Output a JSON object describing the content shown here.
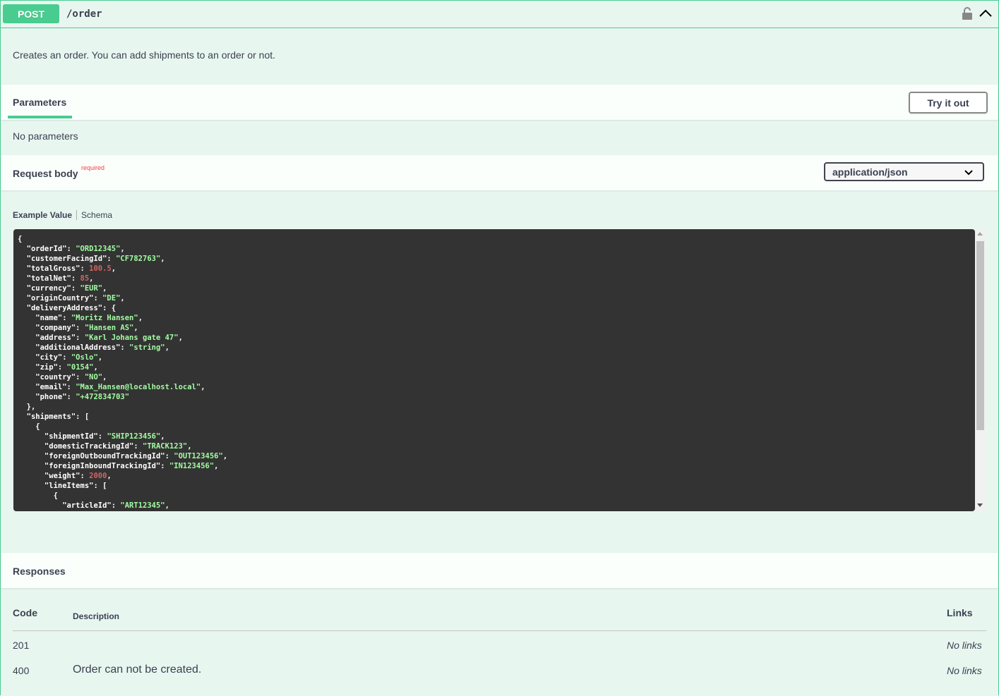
{
  "endpoint": {
    "method": "POST",
    "path": "/order",
    "description": "Creates an order. You can add shipments to an order or not."
  },
  "parameters": {
    "title": "Parameters",
    "try_button": "Try it out",
    "empty_text": "No parameters"
  },
  "request_body": {
    "title": "Request body",
    "required_label": "required",
    "content_type": "application/json",
    "tab_example": "Example Value",
    "tab_schema": "Schema",
    "example_lines": [
      "{",
      "  \"orderId\": \"ORD12345\",",
      "  \"customerFacingId\": \"CF782763\",",
      "  \"totalGross\": 100.5,",
      "  \"totalNet\": 85,",
      "  \"currency\": \"EUR\",",
      "  \"originCountry\": \"DE\",",
      "  \"deliveryAddress\": {",
      "    \"name\": \"Moritz Hansen\",",
      "    \"company\": \"Hansen AS\",",
      "    \"address\": \"Karl Johans gate 47\",",
      "    \"additionalAddress\": \"string\",",
      "    \"city\": \"Oslo\",",
      "    \"zip\": \"0154\",",
      "    \"country\": \"NO\",",
      "    \"email\": \"Max_Hansen@localhost.local\",",
      "    \"phone\": \"+472834703\"",
      "  },",
      "  \"shipments\": [",
      "    {",
      "      \"shipmentId\": \"SHIP123456\",",
      "      \"domesticTrackingId\": \"TRACK123\",",
      "      \"foreignOutboundTrackingId\": \"OUT123456\",",
      "      \"foreignInboundTrackingId\": \"IN123456\",",
      "      \"weight\": 2000,",
      "      \"lineItems\": [",
      "        {",
      "          \"articleId\": \"ART12345\","
    ]
  },
  "responses": {
    "title": "Responses",
    "col_code": "Code",
    "col_description": "Description",
    "col_links": "Links",
    "rows": [
      {
        "code": "201",
        "description": "",
        "links": "No links"
      },
      {
        "code": "400",
        "description": "Order can not be created.",
        "links": "No links"
      }
    ]
  },
  "colors": {
    "post_accent": "#49cc90",
    "background": "#e8f6f0",
    "code_bg": "#333333",
    "string": "#a2fca2",
    "number": "#d36363",
    "required": "#f93e3e"
  },
  "icons": [
    "lock-icon",
    "chevron-up-icon",
    "chevron-down-icon"
  ]
}
